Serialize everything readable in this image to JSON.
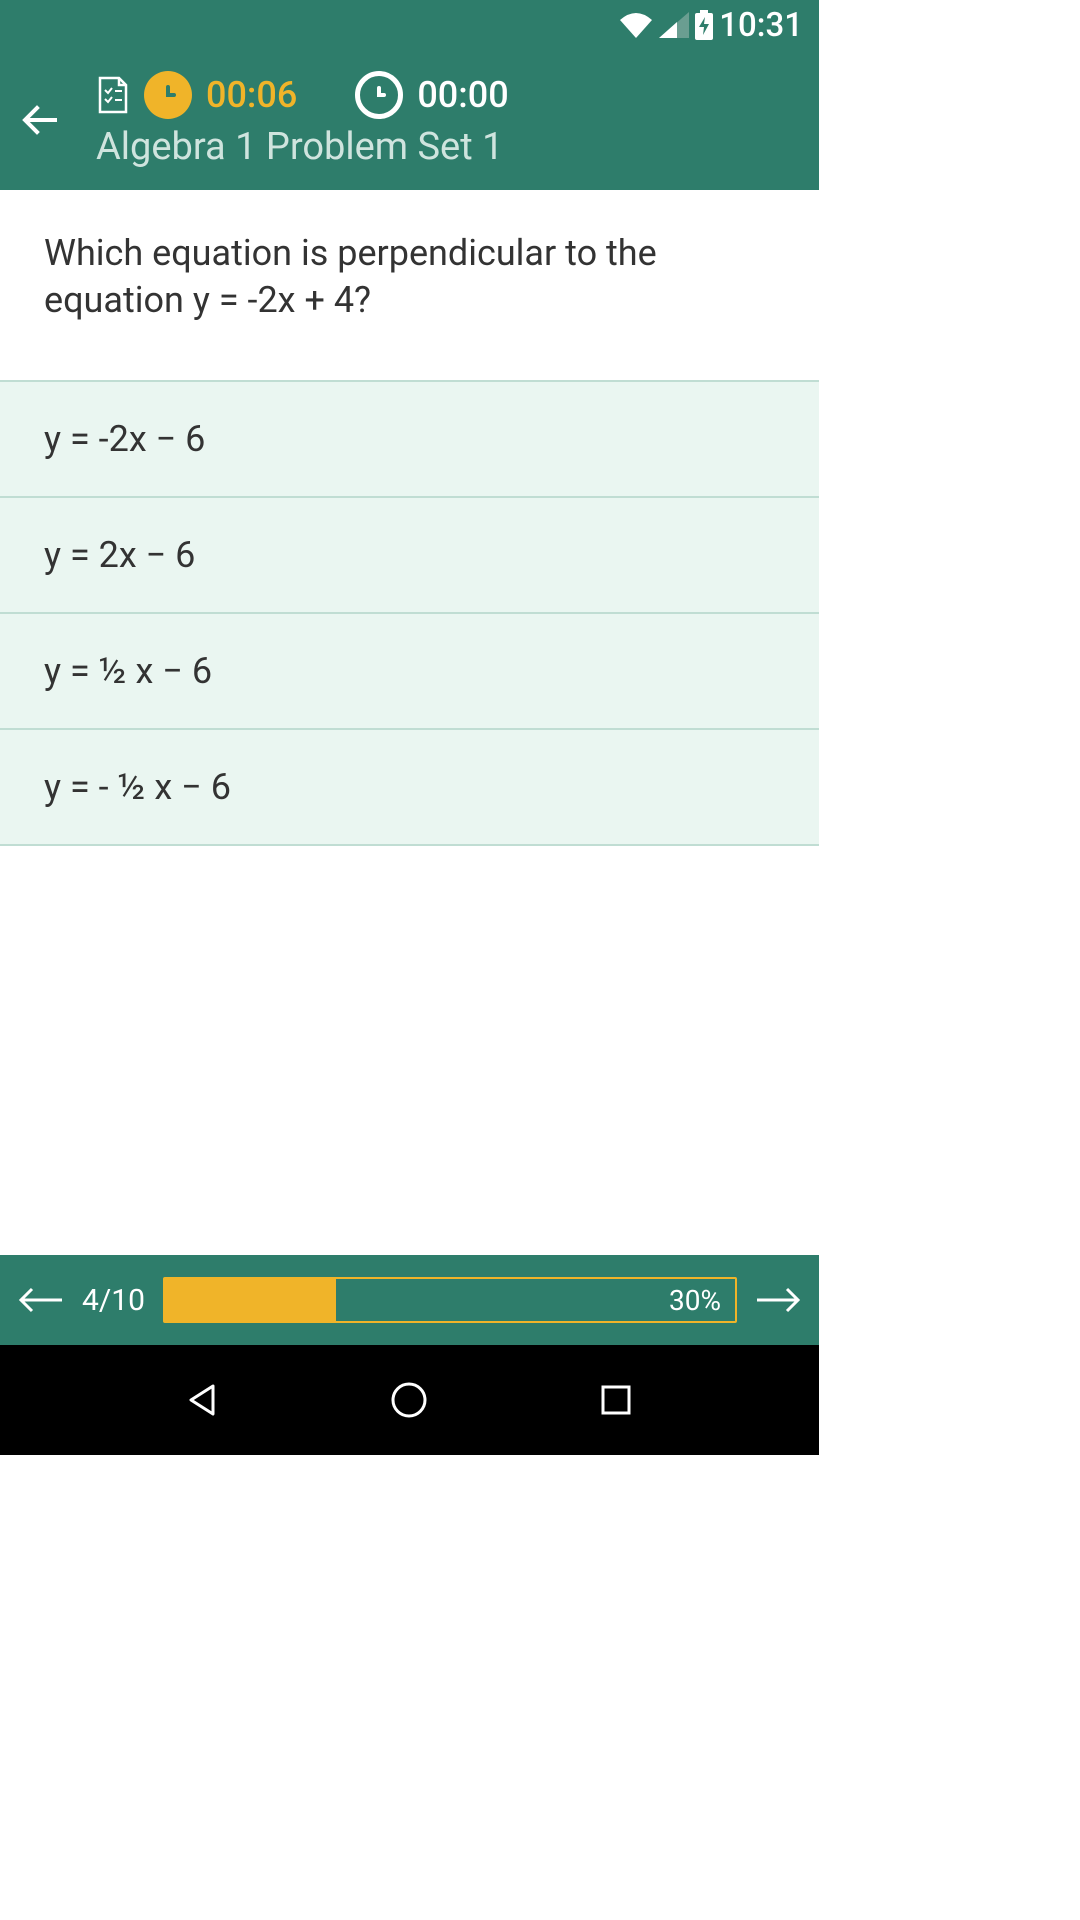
{
  "status": {
    "time": "10:31"
  },
  "header": {
    "timer1": "00:06",
    "timer2": "00:00",
    "title": "Algebra 1 Problem Set 1"
  },
  "question": "Which equation is perpendicular to the equation y = -2x + 4?",
  "answers": [
    "y = -2x − 6",
    "y = 2x − 6",
    "y = ½ x − 6",
    "y = - ½ x − 6"
  ],
  "footer": {
    "page": "4/10",
    "progress_percent": 30,
    "progress_label": "30%"
  }
}
